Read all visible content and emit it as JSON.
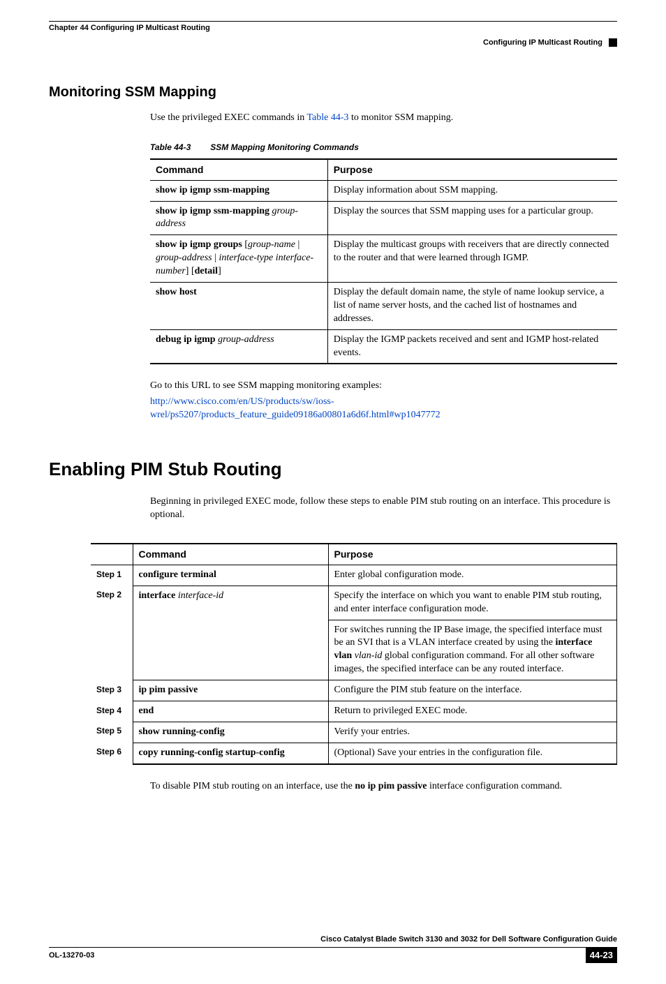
{
  "header": {
    "chapter": "Chapter 44      Configuring IP Multicast Routing",
    "section_right": "Configuring IP Multicast Routing"
  },
  "sections": {
    "ssm_title": "Monitoring SSM Mapping",
    "ssm_intro_pre": "Use the privileged EXEC commands in ",
    "ssm_intro_link": "Table 44-3",
    "ssm_intro_post": " to monitor SSM mapping.",
    "table_caption_label": "Table 44-3",
    "table_caption_title": "SSM Mapping Monitoring Commands",
    "th_command": "Command",
    "th_purpose": "Purpose",
    "rows": [
      {
        "cmd_html": "<span class='b'>show ip igmp ssm-mapping</span>",
        "purpose": "Display information about SSM mapping."
      },
      {
        "cmd_html": "<span class='b'>show ip igmp ssm-mapping</span> <span class='i'>group-address</span>",
        "purpose": "Display the sources that SSM mapping uses for a particular group."
      },
      {
        "cmd_html": "<span class='b'>show ip igmp groups</span> [<span class='i'>group-name</span> | <span class='i'>group-address</span> | <span class='i'>interface-type interface-number</span>] [<span class='b'>detail</span>]",
        "purpose": "Display the multicast groups with receivers that are directly connected to the router and that were learned through IGMP."
      },
      {
        "cmd_html": "<span class='b'>show host</span>",
        "purpose": "Display the default domain name, the style of name lookup service, a list of name server hosts, and the cached list of hostnames and addresses."
      },
      {
        "cmd_html": "<span class='b'>debug ip igmp</span> <span class='i'>group-address</span>",
        "purpose": "Display the IGMP packets received and sent and IGMP host-related events."
      }
    ],
    "ssm_url_lead": "Go to this URL to see SSM mapping monitoring examples:",
    "ssm_url": "http://www.cisco.com/en/US/products/sw/ioss-wrel/ps5207/products_feature_guide09186a00801a6d6f.html#wp1047772",
    "pim_title": "Enabling PIM Stub Routing",
    "pim_intro": "Beginning in privileged EXEC mode, follow these steps to enable PIM stub routing on an interface. This procedure is optional.",
    "steps_th_command": "Command",
    "steps_th_purpose": "Purpose",
    "steps": [
      {
        "step": "Step 1",
        "cmd_html": "<span class='b'>configure terminal</span>",
        "purpose_html": "Enter global configuration mode."
      },
      {
        "step": "Step 2",
        "cmd_html": "<span class='b'>interface</span> <span class='i'>interface-id</span>",
        "purpose_html": "Specify the interface on which you want to enable PIM stub routing, and enter interface configuration mode.",
        "purpose2_html": "For switches running the IP Base image, the specified interface must be an SVI that is a VLAN interface created by using the <span class='b'>interface vlan</span> <span class='i'>vlan-id</span> global configuration command. For all other software images, the specified interface can be any routed interface."
      },
      {
        "step": "Step 3",
        "cmd_html": "<span class='b'>ip pim passive</span>",
        "purpose_html": "Configure the PIM stub feature on the interface."
      },
      {
        "step": "Step 4",
        "cmd_html": "<span class='b'>end</span>",
        "purpose_html": "Return to privileged EXEC mode."
      },
      {
        "step": "Step 5",
        "cmd_html": "<span class='b'>show running-config</span>",
        "purpose_html": "Verify your entries."
      },
      {
        "step": "Step 6",
        "cmd_html": "<span class='b'>copy running-config startup-config</span>",
        "purpose_html": "(Optional) Save your entries in the configuration file."
      }
    ],
    "pim_outro_pre": "To disable PIM stub routing on an interface, use the ",
    "pim_outro_cmd": "no ip pim passive",
    "pim_outro_post": " interface configuration command."
  },
  "footer": {
    "guide": "Cisco Catalyst Blade Switch 3130 and 3032 for Dell Software Configuration Guide",
    "docid": "OL-13270-03",
    "page": "44-23"
  }
}
